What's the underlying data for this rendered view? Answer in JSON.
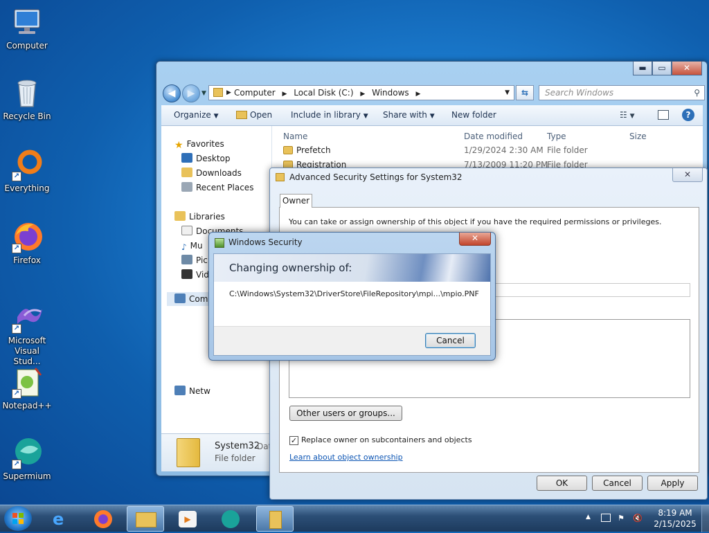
{
  "desktop": {
    "icons": [
      {
        "label": "Computer"
      },
      {
        "label": "Recycle Bin"
      },
      {
        "label": "Everything"
      },
      {
        "label": "Firefox"
      },
      {
        "label": "Microsoft Visual Stud..."
      },
      {
        "label": "Notepad++"
      },
      {
        "label": "Supermium"
      }
    ]
  },
  "explorer": {
    "caption_buttons": {
      "minimize": "▬",
      "maximize": "▭",
      "close": "✕"
    },
    "address": {
      "segments": [
        "Computer",
        "Local Disk (C:)",
        "Windows"
      ]
    },
    "search_placeholder": "Search Windows",
    "toolbar": {
      "organize": "Organize",
      "open": "Open",
      "include_in_library": "Include in library",
      "share_with": "Share with",
      "new_folder": "New folder"
    },
    "nav": {
      "favorites": "Favorites",
      "desktop": "Desktop",
      "downloads": "Downloads",
      "recent_places": "Recent Places",
      "libraries": "Libraries",
      "documents": "Documents",
      "music": "Mu",
      "pictures": "Pic",
      "videos": "Vid",
      "computer": "Comp",
      "network": "Netw"
    },
    "columns": {
      "name": "Name",
      "date_modified": "Date modified",
      "type": "Type",
      "size": "Size"
    },
    "files": [
      {
        "name": "Prefetch",
        "date": "1/29/2024 2:30 AM",
        "type": "File folder"
      },
      {
        "name": "Registration",
        "date": "7/13/2009 11:20 PM",
        "type": "File folder"
      }
    ],
    "details": {
      "name": "System32",
      "type": "File folder",
      "date_label": "Dat"
    }
  },
  "advanced_security": {
    "title": "Advanced Security Settings for System32",
    "close": "✕",
    "tab": "Owner",
    "description": "You can take or assign ownership of this object if you have the required permissions or privileges.",
    "other_users_button": "Other users or groups...",
    "replace_owner_checkbox": "Replace owner on subcontainers and objects",
    "replace_owner_checked": true,
    "learn_link": "Learn about object ownership",
    "ok": "OK",
    "cancel": "Cancel",
    "apply": "Apply"
  },
  "windows_security": {
    "title": "Windows Security",
    "close": "✕",
    "heading": "Changing ownership of:",
    "path": "C:\\Windows\\System32\\DriverStore\\FileRepository\\mpi...\\mpio.PNF",
    "cancel": "Cancel"
  },
  "taskbar": {
    "time": "8:19 AM",
    "date": "2/15/2025",
    "tray_arrow": "▲"
  }
}
